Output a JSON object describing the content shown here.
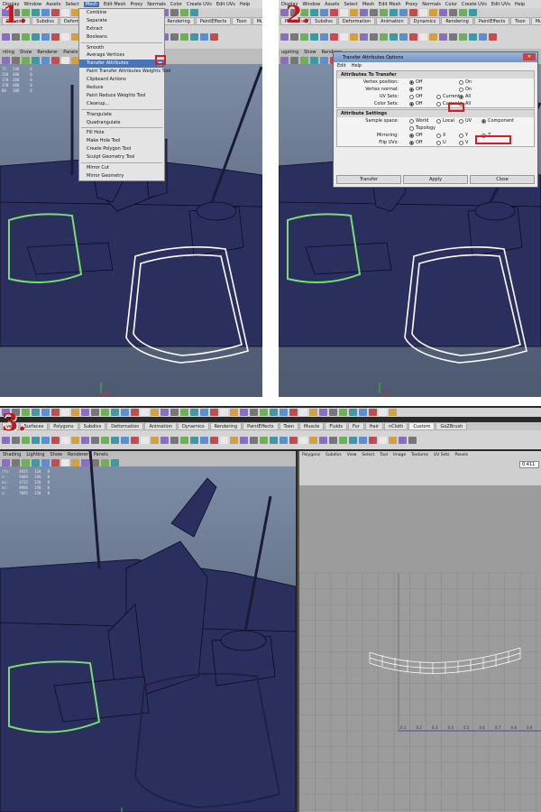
{
  "steps": [
    "1.",
    "2.",
    "3."
  ],
  "menubar": [
    "Display",
    "Window",
    "Assets",
    "Select",
    "Mesh",
    "Edit Mesh",
    "Proxy",
    "Normals",
    "Color",
    "Create UVs",
    "Edit UVs",
    "Help"
  ],
  "menubar_active": "Mesh",
  "shelf_tabs": [
    "Polygons",
    "Subdivs",
    "Deformation",
    "Animation",
    "Dynamics",
    "Rendering",
    "PaintEffects",
    "Toon",
    "Muscle"
  ],
  "shelf_tabs_p3": [
    "ves",
    "Surfaces",
    "Polygons",
    "Subdivs",
    "Deformation",
    "Animation",
    "Dynamics",
    "Rendering",
    "PaintEffects",
    "Toon",
    "Muscle",
    "Fluids",
    "Fur",
    "Hair",
    "nCloth",
    "Custom",
    "GoZBrush"
  ],
  "viewport_menu": [
    "Shading",
    "Lighting",
    "Show",
    "Renderer",
    "Panels"
  ],
  "viewport_menu_p1": [
    "nting",
    "Show",
    "Renderer",
    "Panels"
  ],
  "viewport_menu_p2": [
    "ugeting",
    "Show",
    "Renderer"
  ],
  "hud_p1": [
    "75   240     0",
    "320  400     0",
    "170  200     0",
    "170  400     0",
    "80   300     0"
  ],
  "hud_p3": [
    "rts:    4835   120   0",
    "s:      9409   240   0",
    "es:     4732   120   0",
    "ns:     8966   240   0",
    "s:      7095   150   0"
  ],
  "mesh_menu": {
    "items": [
      {
        "label": "Combine"
      },
      {
        "label": "Separate"
      },
      {
        "label": "Extract"
      },
      {
        "label": "Booleans"
      },
      {
        "sep": true
      },
      {
        "label": "Smooth"
      },
      {
        "label": "Average Vertices"
      },
      {
        "label": "Transfer Attributes",
        "active": true
      },
      {
        "label": "Paint Transfer Attributes Weights Tool"
      },
      {
        "label": "Clipboard Actions"
      },
      {
        "label": "Reduce"
      },
      {
        "label": "Paint Reduce Weights Tool"
      },
      {
        "label": "Cleanup..."
      },
      {
        "sep": true
      },
      {
        "label": "Triangulate"
      },
      {
        "label": "Quadrangulate"
      },
      {
        "sep": true
      },
      {
        "label": "Fill Hole"
      },
      {
        "label": "Make Hole Tool"
      },
      {
        "label": "Create Polygon Tool"
      },
      {
        "label": "Sculpt Geometry Tool"
      },
      {
        "sep": true
      },
      {
        "label": "Mirror Cut"
      },
      {
        "label": "Mirror Geometry"
      }
    ]
  },
  "dialog": {
    "title": "Transfer Attributes Options",
    "menu": [
      "Edit",
      "Help"
    ],
    "section1": "Attributes To Transfer",
    "section2": "Attribute Settings",
    "rows1": [
      {
        "label": "Vertex position:",
        "opts": [
          "Off",
          "",
          "On"
        ],
        "sel": 0
      },
      {
        "label": "Vertex normal:",
        "opts": [
          "Off",
          "",
          "On"
        ],
        "sel": 0
      },
      {
        "label": "UV Sets:",
        "opts": [
          "Off",
          "Current",
          "All"
        ],
        "sel": 2
      },
      {
        "label": "Color Sets:",
        "opts": [
          "Off",
          "Current",
          "All"
        ],
        "sel": 0
      }
    ],
    "rows2": [
      {
        "label": "Sample space:",
        "opts": [
          "World",
          "Local",
          "UV",
          "Component"
        ],
        "sel": 3
      },
      {
        "label": "",
        "opts": [
          "Topology"
        ],
        "sel": -1
      },
      {
        "label": "Mirroring:",
        "opts": [
          "Off",
          "X",
          "Y",
          "Z"
        ],
        "sel": 0
      },
      {
        "label": "Flip UVs:",
        "opts": [
          "Off",
          "U",
          "V"
        ],
        "sel": 0
      }
    ],
    "buttons": [
      "Transfer",
      "Apply",
      "Close"
    ]
  },
  "uv_editor": {
    "menu": [
      "Polygons",
      "Subdivs",
      "View",
      "Select",
      "Tool",
      "Image",
      "Textures",
      "UV Sets",
      "Panels"
    ],
    "field_value": "0.411",
    "axis_labels": [
      "0.1",
      "0.2",
      "0.3",
      "0.4",
      "0.5",
      "0.6",
      "0.7",
      "0.8",
      "0.9"
    ]
  },
  "colors": {
    "highlight_red": "#e01a1a",
    "menu_blue": "#4a74b9",
    "edge_green": "#6ed86e",
    "mesh_navy": "#2a2d58"
  }
}
